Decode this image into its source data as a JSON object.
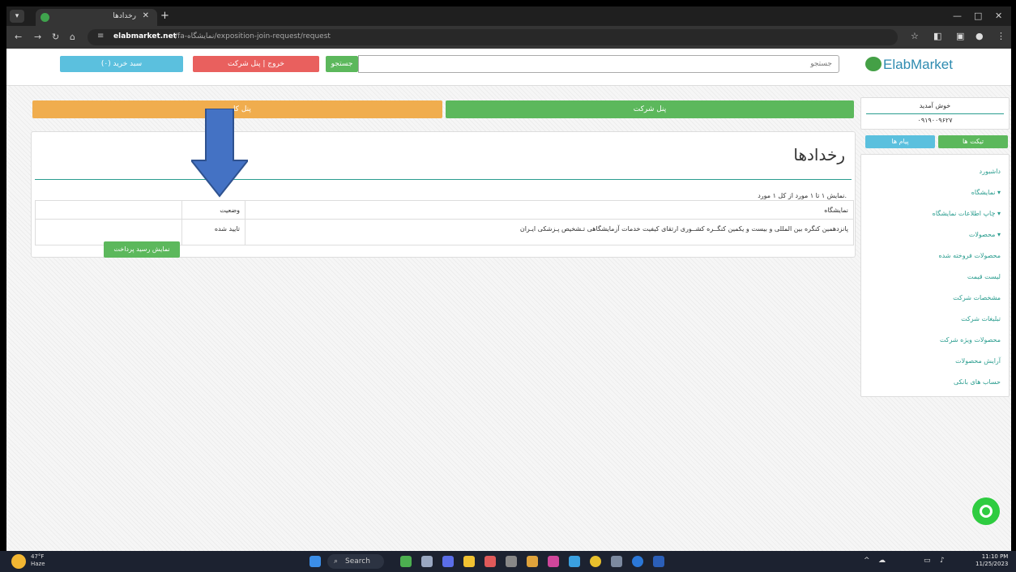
{
  "browser": {
    "tab_title": "رخدادها",
    "tab_close": "✕",
    "new_tab": "+",
    "url_host": "elabmarket.net",
    "url_path": "/fa-نمایشگاه/exposition-join-request/request"
  },
  "nav": {
    "cart_label": "سبد خرید (۰)",
    "panel_label": "خروج | پنل شرکت",
    "search_button": "جستجو",
    "search_placeholder": "جستجو",
    "logo_text": "ElabMarket"
  },
  "sidebar": {
    "welcome": "خوش آمدید",
    "phone": "۰۹۱۹۰۰۹۶۲۷",
    "tickets_label": "تیکت ها",
    "messages_label": "پیام ها",
    "items": [
      {
        "label": "داشبورد"
      },
      {
        "label": "نمایشگاه ▾"
      },
      {
        "label": "چاپ اطلاعات نمایشگاه ▾"
      },
      {
        "label": "محصولات ▾"
      },
      {
        "label": "محصولات فروخته شده"
      },
      {
        "label": "لیست قیمت"
      },
      {
        "label": "مشخصات شرکت"
      },
      {
        "label": "تبلیغات شرکت"
      },
      {
        "label": "محصولات ویژه شرکت"
      },
      {
        "label": "آرایش محصولات"
      },
      {
        "label": "حساب های بانکی"
      }
    ]
  },
  "main": {
    "panel_company": "پنل شرکت",
    "panel_other": "پنل کاربر",
    "title": "رخدادها",
    "summary": "نمایش ۱ تا ۱ مورد از کل ۱ مورد.",
    "table": {
      "headers": [
        "نمایشگاه",
        "وضعیت",
        ""
      ],
      "rows": [
        {
          "exhibition": "پانزدهمین کنگره بین المللی و بیست و یکمین کنگــره کشــوری ارتقای کیفیت خدمات آزمایشگاهی تـشخیص پـزشکی ایـران",
          "status": "تایید شده",
          "action": "نمایش رسید پرداخت"
        }
      ]
    }
  },
  "taskbar": {
    "temperature": "47°F",
    "weather": "Haze",
    "search_label": "Search",
    "time": "11:10 PM",
    "date": "11/25/2023"
  },
  "colors": {
    "green": "#5cb85c",
    "orange": "#f0ad4e",
    "blue": "#5bc0de",
    "red": "#e9605e",
    "teal": "#2a9d8f",
    "arrow": "#4472c4"
  }
}
